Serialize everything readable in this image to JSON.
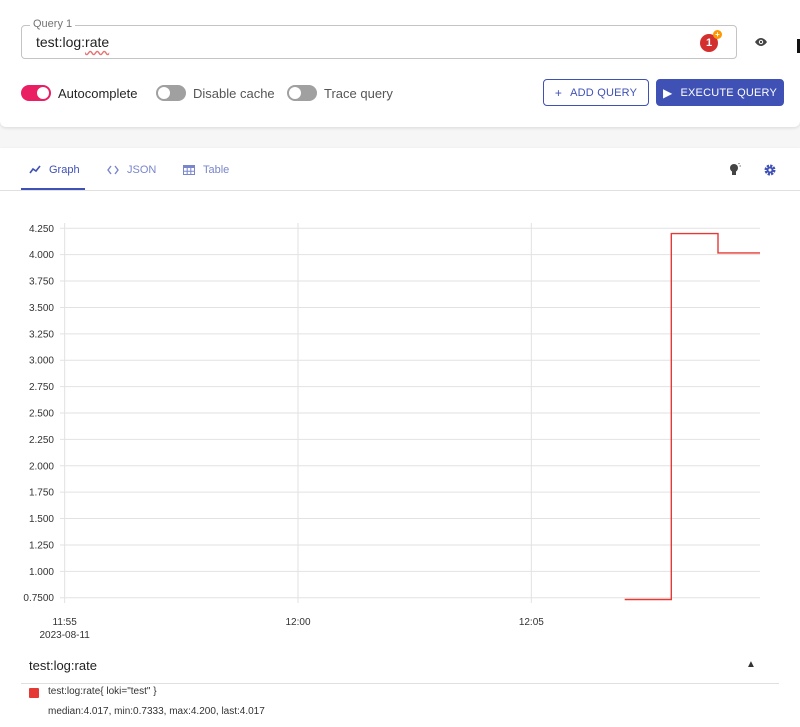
{
  "query": {
    "legend": "Query 1",
    "value": "test:log:rate",
    "value_plain": "test:log:",
    "value_squiggle": "rate",
    "badge_count": "1"
  },
  "toggles": [
    {
      "label": "Autocomplete",
      "state": "on"
    },
    {
      "label": "Disable cache",
      "state": "off"
    },
    {
      "label": "Trace query",
      "state": "off"
    }
  ],
  "buttons": {
    "add_query": "ADD QUERY",
    "execute_query": "EXECUTE QUERY"
  },
  "tabs": [
    {
      "label": "Graph",
      "icon": "chart-line-icon",
      "active": true
    },
    {
      "label": "JSON",
      "icon": "code-icon",
      "active": false
    },
    {
      "label": "Table",
      "icon": "table-icon",
      "active": false
    }
  ],
  "chart_data": {
    "type": "line",
    "y_ticks": [
      "0.7500",
      "1.000",
      "1.250",
      "1.500",
      "1.750",
      "2.000",
      "2.250",
      "2.500",
      "2.750",
      "3.000",
      "3.250",
      "3.500",
      "3.750",
      "4.000",
      "4.250"
    ],
    "y_tick_values": [
      0.75,
      1.0,
      1.25,
      1.5,
      1.75,
      2.0,
      2.25,
      2.5,
      2.75,
      3.0,
      3.25,
      3.5,
      3.75,
      4.0,
      4.25
    ],
    "ylim": [
      0.7,
      4.3
    ],
    "x_ticks": [
      {
        "label": "11:55",
        "sublabel": "2023-08-11",
        "minute": 0
      },
      {
        "label": "12:00",
        "sublabel": "",
        "minute": 5
      },
      {
        "label": "12:05",
        "sublabel": "",
        "minute": 10
      }
    ],
    "xlim_minutes": [
      -0.1,
      14.9
    ],
    "series": [
      {
        "name": "test:log:rate{ loki=\"test\" }",
        "color": "#e53935",
        "points": [
          [
            12.0,
            0.7333
          ],
          [
            13.0,
            0.7333
          ],
          [
            13.0,
            4.2
          ],
          [
            14.0,
            4.2
          ],
          [
            14.0,
            4.017
          ],
          [
            14.9,
            4.017
          ]
        ]
      }
    ],
    "grid": true
  },
  "legend": {
    "title": "test:log:rate",
    "series_label": "test:log:rate{ loki=\"test\" }",
    "stats": "median:4.017, min:0.7333, max:4.200, last:4.017"
  },
  "colors": {
    "primary": "#3f51b5",
    "toggle_on": "#e91e63",
    "series": "#e53935"
  }
}
